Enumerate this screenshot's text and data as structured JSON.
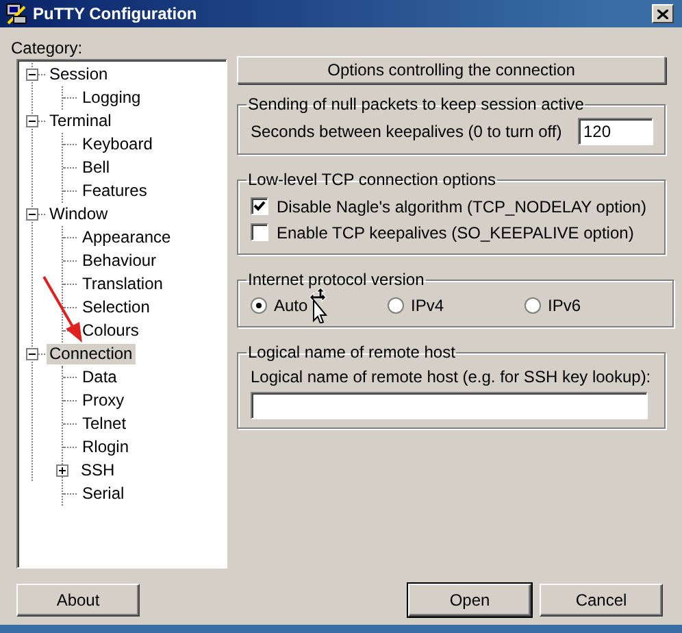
{
  "window": {
    "title": "PuTTY Configuration"
  },
  "category_label": "Category:",
  "tree": [
    {
      "label": "Session",
      "expanded": true,
      "selected": false,
      "children": [
        {
          "label": "Logging",
          "selected": false
        }
      ]
    },
    {
      "label": "Terminal",
      "expanded": true,
      "selected": false,
      "children": [
        {
          "label": "Keyboard",
          "selected": false
        },
        {
          "label": "Bell",
          "selected": false
        },
        {
          "label": "Features",
          "selected": false
        }
      ]
    },
    {
      "label": "Window",
      "expanded": true,
      "selected": false,
      "children": [
        {
          "label": "Appearance",
          "selected": false
        },
        {
          "label": "Behaviour",
          "selected": false
        },
        {
          "label": "Translation",
          "selected": false
        },
        {
          "label": "Selection",
          "selected": false
        },
        {
          "label": "Colours",
          "selected": false
        }
      ]
    },
    {
      "label": "Connection",
      "expanded": true,
      "selected": true,
      "children": [
        {
          "label": "Data",
          "selected": false
        },
        {
          "label": "Proxy",
          "selected": false
        },
        {
          "label": "Telnet",
          "selected": false
        },
        {
          "label": "Rlogin",
          "selected": false
        },
        {
          "label": "SSH",
          "expanded": false,
          "selected": false
        },
        {
          "label": "Serial",
          "selected": false
        }
      ]
    }
  ],
  "panel": {
    "heading": "Options controlling the connection",
    "groups": [
      {
        "kind": "number",
        "title": "Sending of null packets to keep session active",
        "label": "Seconds between keepalives (0 to turn off)",
        "value": "120"
      },
      {
        "kind": "checkboxes",
        "title": "Low-level TCP connection options",
        "options": [
          {
            "label": "Disable Nagle's algorithm (TCP_NODELAY option)",
            "checked": true
          },
          {
            "label": "Enable TCP keepalives (SO_KEEPALIVE option)",
            "checked": false
          }
        ]
      },
      {
        "kind": "radios",
        "title": "Internet protocol version",
        "options": [
          {
            "label": "Auto",
            "selected": true
          },
          {
            "label": "IPv4",
            "selected": false
          },
          {
            "label": "IPv6",
            "selected": false
          }
        ]
      },
      {
        "kind": "text",
        "title": "Logical name of remote host",
        "label": "Logical name of remote host (e.g. for SSH key lookup):"
      }
    ]
  },
  "buttons": [
    {
      "label": "About",
      "default": false
    },
    {
      "label": "Open",
      "default": true
    },
    {
      "label": "Cancel",
      "default": false
    }
  ]
}
